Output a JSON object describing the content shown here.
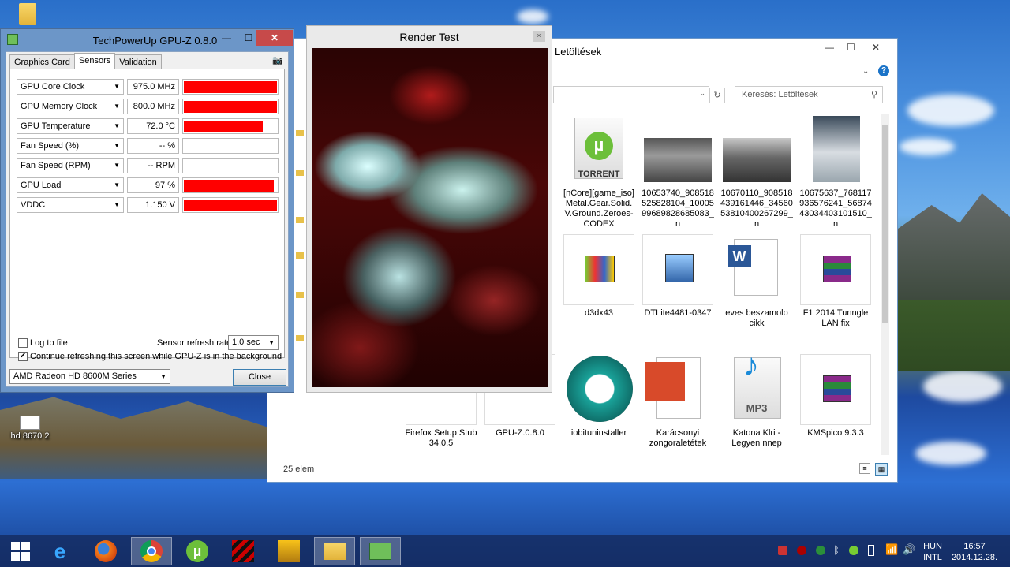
{
  "desktop": {
    "icons": [
      {
        "label": ""
      },
      {
        "label": "hd 8670 2"
      }
    ]
  },
  "gpuz": {
    "title": "TechPowerUp GPU-Z 0.8.0",
    "tabs": [
      "Graphics Card",
      "Sensors",
      "Validation"
    ],
    "active_tab": "Sensors",
    "sensors": [
      {
        "name": "GPU Core Clock",
        "value": "975.0 MHz",
        "level": 1.0
      },
      {
        "name": "GPU Memory Clock",
        "value": "800.0 MHz",
        "level": 1.0
      },
      {
        "name": "GPU Temperature",
        "value": "72.0 °C",
        "level": 0.85
      },
      {
        "name": "Fan Speed (%)",
        "value": "-- %",
        "level": 0
      },
      {
        "name": "Fan Speed (RPM)",
        "value": "-- RPM",
        "level": 0
      },
      {
        "name": "GPU Load",
        "value": "97 %",
        "level": 0.97
      },
      {
        "name": "VDDC",
        "value": "1.150 V",
        "level": 1.0
      }
    ],
    "graph_color": "#ff0000",
    "log_to_file_label": "Log to file",
    "refresh_rate_label": "Sensor refresh rate:",
    "refresh_rate_value": "1.0 sec",
    "continue_label": "Continue refreshing this screen while GPU-Z is in the background",
    "card_select": "AMD Radeon HD 8600M Series",
    "close_label": "Close"
  },
  "render": {
    "title": "Render Test",
    "close_symbol": "×"
  },
  "explorer": {
    "title": "Letöltések",
    "search_placeholder": "Keresés: Letöltések",
    "status": "25 elem",
    "files": [
      {
        "label": "[nCore][game_iso]Metal.Gear.Solid.V.Ground.Zeroes-CODEX",
        "icon": "torrent-icon",
        "icon_text": "TORRENT"
      },
      {
        "label": "10653740_908518525828104_1000599689828685083_n",
        "icon": "photo-thumbnail"
      },
      {
        "label": "10670110_908518439161446_3456053810400267299_n",
        "icon": "photo-thumbnail"
      },
      {
        "label": "10675637_768117936576241_5687443034403101510_n",
        "icon": "photo-thumbnail"
      },
      {
        "label": "d3dx43",
        "icon": "installer-icon"
      },
      {
        "label": "DTLite4481-0347",
        "icon": "installer-icon"
      },
      {
        "label": "eves beszamolo cikk",
        "icon": "word-document-icon"
      },
      {
        "label": "F1 2014 Tunngle LAN fix",
        "icon": "winrar-archive-icon"
      },
      {
        "label": "Firefox Setup Stub 34.0.5",
        "icon": "installer-icon"
      },
      {
        "label": "GPU-Z.0.8.0",
        "icon": "gpuz-icon"
      },
      {
        "label": "iobituninstaller",
        "icon": "uninstaller-icon"
      },
      {
        "label": "Karácsonyi zongoraletétek",
        "icon": "pdf-icon"
      },
      {
        "label": "Katona  Klri - Legyen nnep",
        "icon": "mp3-icon",
        "icon_text": "MP3"
      },
      {
        "label": "KMSpico 9.3.3",
        "icon": "winrar-archive-icon"
      }
    ]
  },
  "taskbar": {
    "language": "HUN",
    "layout": "INTL",
    "time": "16:57",
    "date": "2014.12.28."
  }
}
